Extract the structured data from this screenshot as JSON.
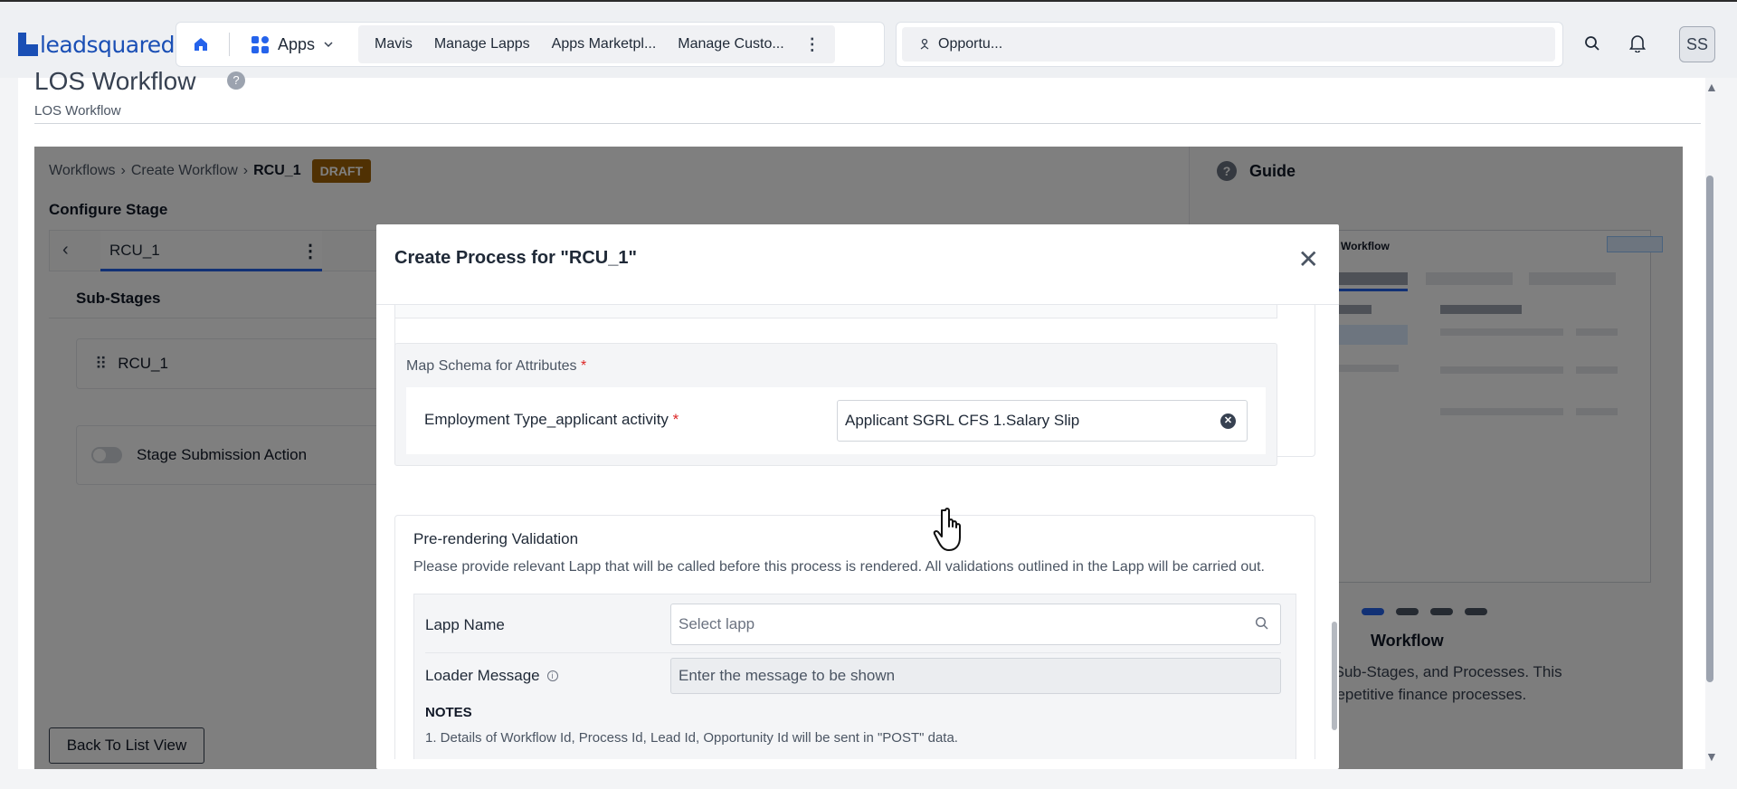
{
  "brand": {
    "logo_text": "leadsquared"
  },
  "topbar": {
    "apps_label": "Apps",
    "tabs": [
      "Mavis",
      "Manage Lapps",
      "Apps Marketpl...",
      "Manage Custo..."
    ],
    "opportunity_label": "Opportu...",
    "avatar_initials": "SS"
  },
  "page": {
    "title": "LOS Workflow",
    "subtitle": "LOS Workflow"
  },
  "breadcrumb": {
    "items": [
      "Workflows",
      "Create Workflow",
      "RCU_1"
    ],
    "status": "DRAFT"
  },
  "configure": {
    "title": "Configure Stage",
    "stage_tab": "RCU_1",
    "substages_title": "Sub-Stages",
    "substage_item": "RCU_1",
    "submission_action": "Stage Submission Action",
    "back_button": "Back To List View"
  },
  "guide": {
    "title": "Guide",
    "image_caption": "y Workflow",
    "slide_title": "Workflow",
    "desc_line1": "n Stage-Tabs, Sub-Stages, and Processes. This",
    "desc_line2": "e tedious and repetitive finance processes."
  },
  "modal": {
    "title": "Create Process for \"RCU_1\"",
    "schema": {
      "title": "Map Schema for Attributes",
      "required_mark": "*",
      "field_label": "Employment Type_applicant activity",
      "field_value": "Applicant SGRL CFS 1.Salary Slip"
    },
    "pre_render": {
      "title": "Pre-rendering Validation",
      "description": "Please provide relevant Lapp that will be called before this process is rendered. All validations outlined in the Lapp will be carried out.",
      "lapp_label": "Lapp Name",
      "lapp_placeholder": "Select lapp",
      "loader_label": "Loader Message",
      "loader_placeholder": "Enter the message to be shown",
      "notes_title": "NOTES",
      "note_1": "1. Details of Workflow Id, Process Id, Lead Id, Opportunity Id will be sent in \"POST\" data."
    }
  },
  "colors": {
    "brand_blue": "#1a4fb5",
    "accent_blue": "#2563eb",
    "draft_badge": "#a16207",
    "required_red": "#dc2626"
  }
}
